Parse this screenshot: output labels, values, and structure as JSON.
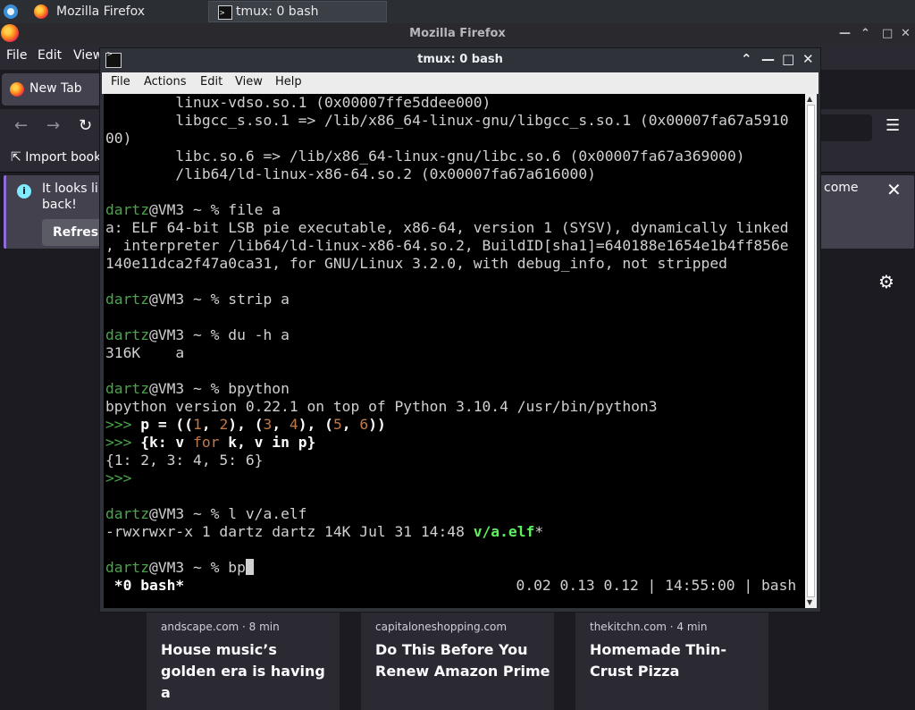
{
  "taskbar": {
    "tasks": [
      {
        "label": "Mozilla Firefox",
        "icon": "firefox-icon"
      },
      {
        "label": "tmux: 0 bash",
        "icon": "terminal-icon"
      }
    ]
  },
  "firefox": {
    "window_title": "Mozilla Firefox",
    "menu": [
      "File",
      "Edit",
      "View"
    ],
    "tab_label": "New Tab",
    "bookmark_import": "Import book",
    "notification": {
      "line1": "It looks lik",
      "line2": "back!",
      "tail": "come",
      "refresh_label": "Refresh"
    },
    "cards": [
      {
        "source": "andscape.com · 8 min",
        "title": "House music’s golden era is having a"
      },
      {
        "source": "capitaloneshopping.com",
        "title": "Do This Before You Renew Amazon Prime"
      },
      {
        "source": "thekitchn.com · 4 min",
        "title": "Homemade Thin-Crust Pizza"
      }
    ],
    "accent_color": "#8f6cd8"
  },
  "terminal": {
    "title": "tmux: 0 bash",
    "menu": [
      "File",
      "Actions",
      "Edit",
      "View",
      "Help"
    ],
    "prompt": {
      "user": "dartz",
      "host": "VM3",
      "rest": " ~ % "
    },
    "lines": {
      "l1": "        linux-vdso.so.1 (0x00007ffe5ddee000)",
      "l2": "        libgcc_s.so.1 => /lib/x86_64-linux-gnu/libgcc_s.so.1 (0x00007fa67a5910",
      "l3": "00)",
      "l4": "        libc.so.6 => /lib/x86_64-linux-gnu/libc.so.6 (0x00007fa67a369000)",
      "l5": "        /lib64/ld-linux-x86-64.so.2 (0x00007fa67a616000)",
      "cmd_file": "file a",
      "file_out1": "a: ELF 64-bit LSB pie executable, x86-64, version 1 (SYSV), dynamically linked",
      "file_out2": ", interpreter /lib64/ld-linux-x86-64.so.2, BuildID[sha1]=640188e1654e1b4ff856e",
      "file_out3": "140e11dca2f47a0ca31, for GNU/Linux 3.2.0, with debug_info, not stripped",
      "cmd_strip": "strip a",
      "cmd_du": "du -h a",
      "du_out": "316K    a",
      "cmd_bpython": "bpython",
      "bpython_ver": "bpython version 0.22.1 on top of Python 3.10.4 /usr/bin/python3",
      "py_prompt": ">>> ",
      "py_dict_out": "{1: 2, 3: 4, 5: 6}",
      "cmd_ls": "l v/a.elf",
      "ls_out_prefix": "-rwxrwxr-x 1 dartz dartz 14K Jul 31 14:48 ",
      "ls_out_file": "v/a.elf",
      "ls_out_suffix": "*",
      "cmd_partial": "bp"
    },
    "status": {
      "left": " *0 bash*",
      "right": "0.02 0.13 0.12 | 14:55:00 | bash "
    }
  }
}
